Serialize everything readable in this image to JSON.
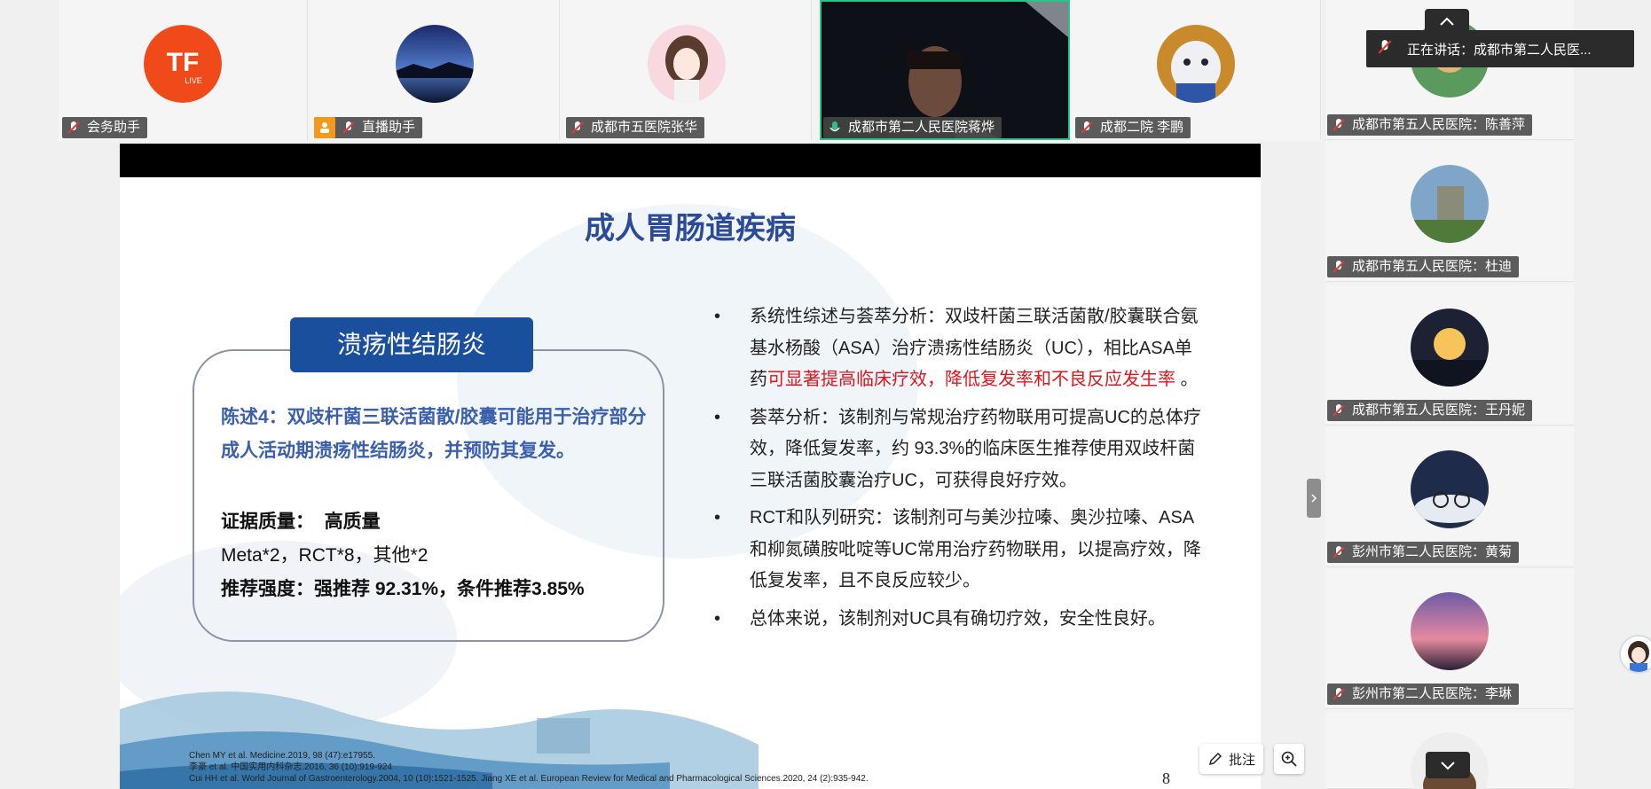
{
  "top_participants": [
    {
      "name": "会务助手",
      "icon": "live-logo"
    },
    {
      "name": "直播助手",
      "icon": "night-lake-avatar"
    },
    {
      "name": "成都市五医院张华",
      "icon": "anime-girl-avatar"
    },
    {
      "name": "成都市第二人民医院蒋烨",
      "icon": "camera-video"
    },
    {
      "name": "成都二院 李鹏",
      "icon": "plush-toy-avatar"
    }
  ],
  "right_participants": [
    {
      "name": "成都市第五人民医院：陈善萍"
    },
    {
      "name": "成都市第五人民医院：杜迪"
    },
    {
      "name": "成都市第五人民医院：王丹妮"
    },
    {
      "name": "彭州市第二人民医院：黄菊"
    },
    {
      "name": "彭州市第二人民医院：李琳"
    }
  ],
  "speaking": {
    "label": "正在讲话：",
    "name": "成都市第二人民医..."
  },
  "slide": {
    "title": "成人胃肠道疾病",
    "tag": "溃疡性结肠炎",
    "statement": "陈述4：双歧杆菌三联活菌散/胶囊可能用于治疗部分成人活动期溃疡性结肠炎，并预防其复发。",
    "evidence_label": "证据质量：",
    "evidence_value": "高质量",
    "studies": "Meta*2，RCT*8，其他*2",
    "recommendation": "推荐强度：强推荐 92.31%，条件推荐3.85%",
    "bullet1_a": "系统性综述与荟萃分析：双歧杆菌三联活菌散/胶囊联合氨基水杨酸（ASA）治疗溃疡性结肠炎（UC），相比ASA单药",
    "bullet1_red": "可显著提高临床疗效，降低复发率和不良反应发生率",
    "bullet1_end": " 。",
    "bullet2": "荟萃分析：该制剂与常规治疗药物联用可提高UC的总体疗效，降低复发率，约 93.3%的临床医生推荐使用双歧杆菌三联活菌胶囊治疗UC，可获得良好疗效。",
    "bullet3": "RCT和队列研究：该制剂可与美沙拉嗪、奥沙拉嗪、ASA和柳氮磺胺吡啶等UC常用治疗药物联用，以提高疗效，降低复发率，且不良反应较少。",
    "bullet4": "总体来说，该制剂对UC具有确切疗效，安全性良好。",
    "ref1": "Chen MY et al. Medicine.2019, 98 (47):e17955.",
    "ref2": "李豪 et al. 中国实用内科杂志.2016, 36 (10):919-924",
    "ref3": "Cui HH et al. World Journal of Gastroenterology.2004, 10 (10):1521-1525. Jiang XE et al. European Review for Medical and Pharmacological Sciences.2020, 24 (2):935-942.",
    "page": "8"
  },
  "toolbar": {
    "annotate_label": "批注"
  }
}
